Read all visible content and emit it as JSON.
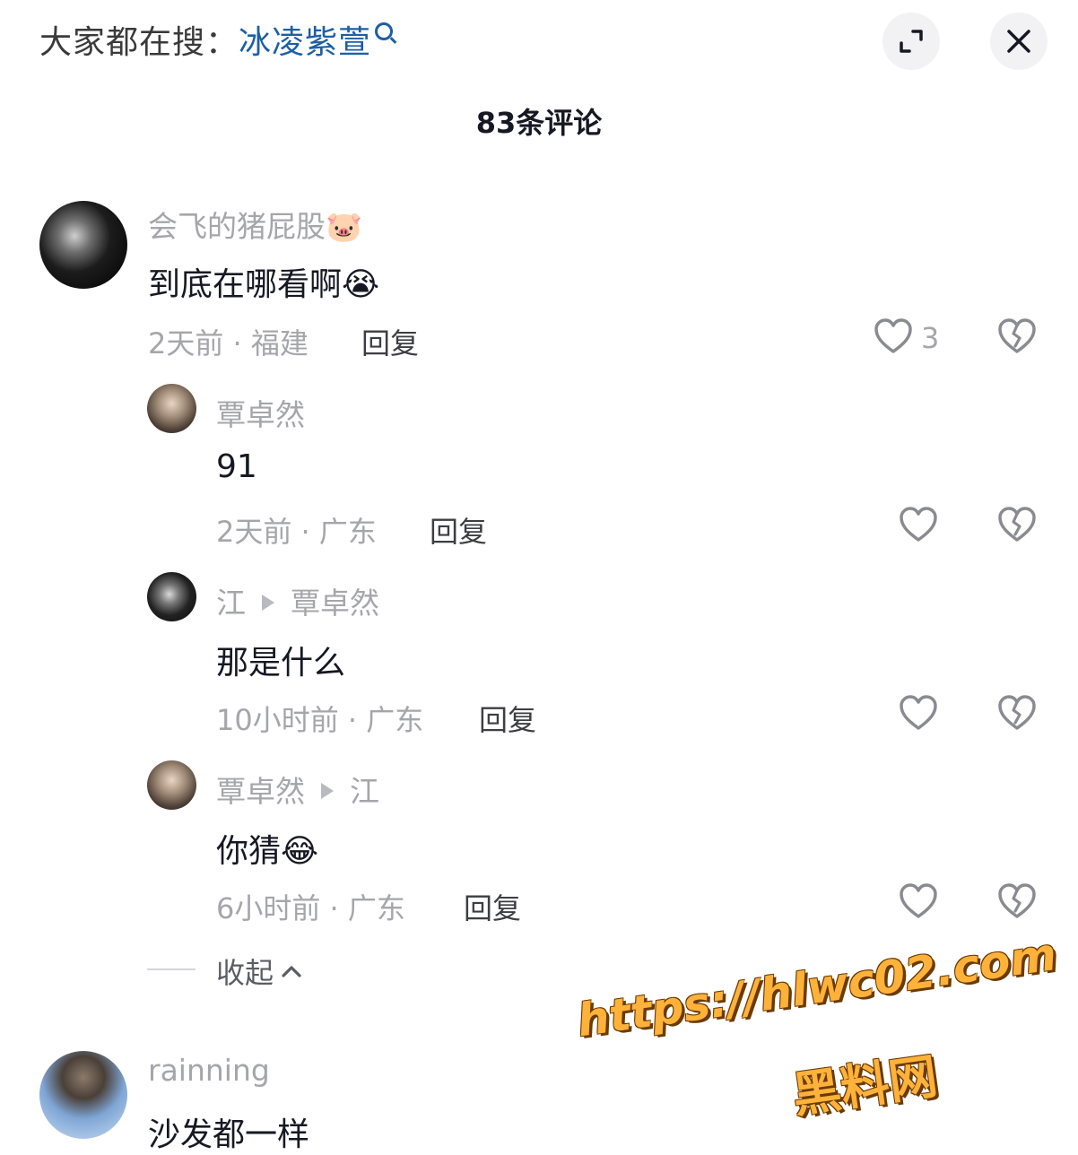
{
  "header": {
    "search_prefix": "大家都在搜：",
    "search_term": "冰凌紫萱",
    "title": "83条评论"
  },
  "comments": [
    {
      "username": "会飞的猪屁股🐷",
      "content": "到底在哪看啊😭",
      "meta": "2天前 · 福建",
      "reply_label": "回复",
      "likes": "3"
    },
    {
      "username": "覃卓然",
      "content": "91",
      "meta": "2天前 · 广东",
      "reply_label": "回复"
    },
    {
      "username": "江",
      "reply_to": "覃卓然",
      "content": "那是什么",
      "meta": "10小时前 · 广东",
      "reply_label": "回复"
    },
    {
      "username": "覃卓然",
      "reply_to": "江",
      "content": "你猜😂",
      "meta": "6小时前 · 广东",
      "reply_label": "回复"
    },
    {
      "username": "rainning",
      "content": "沙发都一样"
    }
  ],
  "collapse_label": "收起",
  "watermark": {
    "url": "https://hlwc02.com",
    "name": "黑料网"
  },
  "icons": {
    "expand": "expand-icon",
    "close": "close-icon",
    "like": "heart-icon",
    "dislike": "broken-heart-icon",
    "collapse": "chevron-up-icon"
  }
}
